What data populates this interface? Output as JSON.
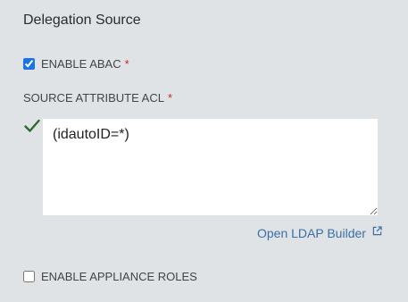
{
  "section": {
    "title": "Delegation Source"
  },
  "enable_abac": {
    "label": "ENABLE ABAC",
    "required_mark": "*",
    "checked": true
  },
  "source_attribute_acl": {
    "label": "SOURCE ATTRIBUTE ACL",
    "required_mark": "*",
    "value": "(idautoID=*)",
    "valid": true,
    "status_icon": "check-icon"
  },
  "ldap_builder": {
    "label": "Open LDAP Builder",
    "icon": "external-link-icon"
  },
  "enable_appliance_roles": {
    "label": "ENABLE APPLIANCE ROLES",
    "checked": false
  },
  "colors": {
    "background": "#dfe3e6",
    "link": "#3a6fa6",
    "required": "#c62828",
    "valid_check": "#2e6b2e"
  }
}
